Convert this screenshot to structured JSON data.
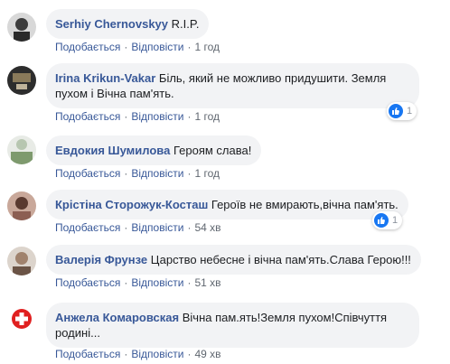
{
  "actions": {
    "like_label": "Подобається",
    "reply_label": "Відповісти",
    "separator": "·"
  },
  "colors": {
    "author": "#385898",
    "bubble": "#f2f3f5",
    "like": "#1877f2",
    "meta": "#606770"
  },
  "comments": [
    {
      "author": "Serhiy Chernovskyy",
      "text": "R.I.P.",
      "time": "1 год"
    },
    {
      "author": "Irina Krikun-Vakar",
      "text": "Біль, який не можливо придушити. Земля пухом і Вічна пам'ять.",
      "time": "1 год",
      "reactions": "1",
      "reaction_icon": "like-icon"
    },
    {
      "author": "Евдокия Шумилова",
      "text": "Героям слава!",
      "time": "1 год"
    },
    {
      "author": "Крістіна Сторожук-Косташ",
      "text": "Героїв не вмирають,вічна пам'ять.",
      "time": "54 хв",
      "reactions": "1",
      "reaction_icon": "like-icon"
    },
    {
      "author": "Валерія Фрунзе",
      "text": "Царство небесне і вічна пам'ять.Слава Герою!!!",
      "time": "51 хв"
    },
    {
      "author": "Анжела Комаровская",
      "text": "Вічна пам.ять!Земля пухом!Співчуття родині...",
      "time": "49 хв"
    }
  ]
}
